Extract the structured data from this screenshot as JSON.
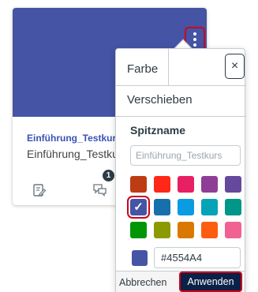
{
  "card": {
    "hero_color": "#4554A4",
    "title": "Einführung_Testkurs",
    "subtitle": "Einführung_Testkurs",
    "discussion_badge": "1",
    "icons": [
      "assignments-icon",
      "discussions-icon"
    ]
  },
  "popover": {
    "tab_color": "Farbe",
    "tab_move": "Verschieben",
    "close_label": "×",
    "nickname_label": "Spitzname",
    "nickname_placeholder": "Einführung_Testkurs",
    "swatches": [
      "#BD3C14",
      "#FF2717",
      "#E71F63",
      "#8F3E97",
      "#65499D",
      "#4554A4",
      "#1770AB",
      "#0B9BE3",
      "#06A3B7",
      "#009688",
      "#009606",
      "#8D9900",
      "#D97900",
      "#FD5D10",
      "#F06291"
    ],
    "selected_swatch_index": 5,
    "hex_value": "#4554A4",
    "cancel_label": "Abbrechen",
    "apply_label": "Anwenden"
  }
}
